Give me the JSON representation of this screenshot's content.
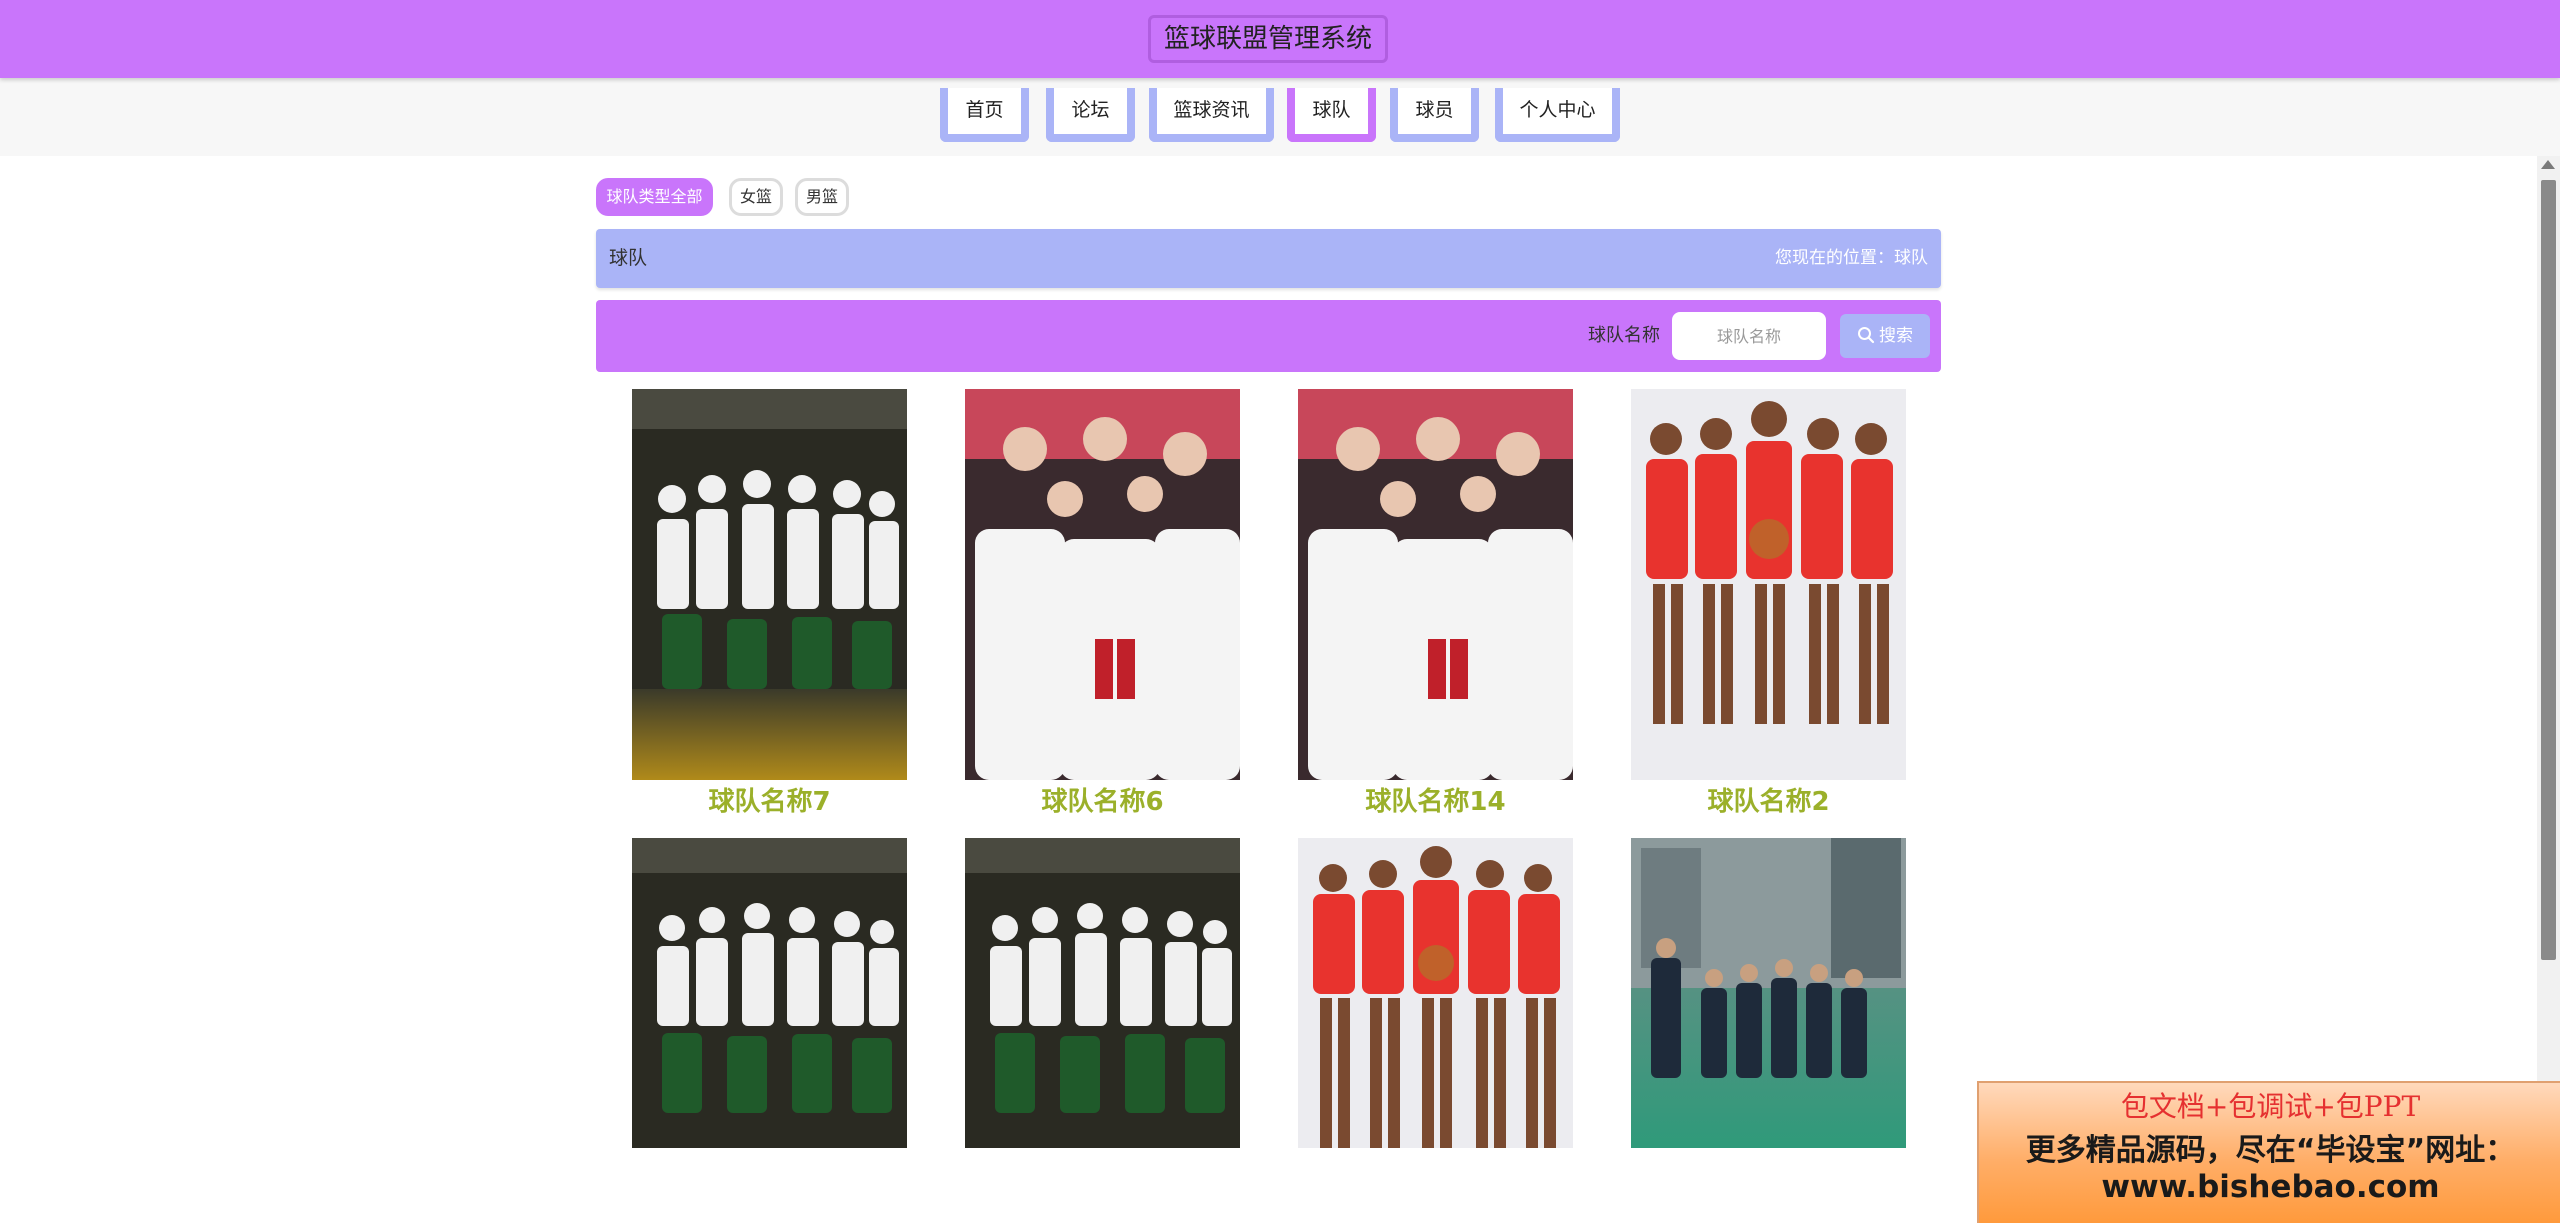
{
  "header": {
    "title": "篮球联盟管理系统",
    "bg_color": "#c975fb"
  },
  "nav": {
    "items": [
      {
        "label": "首页",
        "active": false
      },
      {
        "label": "论坛",
        "active": false
      },
      {
        "label": "篮球资讯",
        "active": false
      },
      {
        "label": "球队",
        "active": true
      },
      {
        "label": "球员",
        "active": false
      },
      {
        "label": "个人中心",
        "active": false
      }
    ],
    "active_color": "#c975fb",
    "inactive_color": "#aab4f7"
  },
  "filters": [
    {
      "label": "球队类型全部",
      "active": true
    },
    {
      "label": "女篮",
      "active": false
    },
    {
      "label": "男篮",
      "active": false
    }
  ],
  "breadcrumb": {
    "title": "球队",
    "location": "您现在的位置：球队"
  },
  "search": {
    "label": "球队名称",
    "placeholder": "球队名称",
    "value": "",
    "button_label": "搜索",
    "button_icon": "search-icon"
  },
  "teams": [
    {
      "name": "球队名称7",
      "image": "celtics-championship-photo"
    },
    {
      "name": "球队名称6",
      "image": "team-huddle-photo"
    },
    {
      "name": "球队名称14",
      "image": "team-huddle-photo"
    },
    {
      "name": "球队名称2",
      "image": "cavaliers-lineup-photo"
    },
    {
      "name": "",
      "image": "celtics-championship-photo"
    },
    {
      "name": "",
      "image": "celtics-championship-photo"
    },
    {
      "name": "",
      "image": "cavaliers-lineup-photo"
    },
    {
      "name": "",
      "image": "amateur-team-outdoor-photo"
    }
  ],
  "team_name_color": "#9bb02a",
  "promo": {
    "line1": "包文档+包调试+包PPT",
    "line2": "更多精品源码，尽在“毕设宝”网址：",
    "line3": "www.bishebao.com"
  }
}
